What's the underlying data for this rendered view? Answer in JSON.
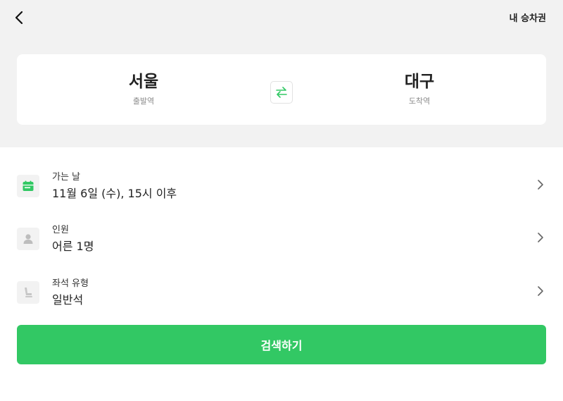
{
  "header": {
    "back_icon": "chevron-left-icon",
    "tickets_label": "내 승차권"
  },
  "route": {
    "departure": {
      "name": "서울",
      "role": "출발역"
    },
    "arrival": {
      "name": "대구",
      "role": "도착역"
    },
    "swap_icon": "swap-arrows-icon",
    "swap_color": "#32c864"
  },
  "options": [
    {
      "label": "가는 날",
      "value": "11월 6일 (수), 15시 이후",
      "icon": "calendar-icon",
      "icon_color": "#32c864"
    },
    {
      "label": "인원",
      "value": "어른 1명",
      "icon": "person-icon",
      "icon_color": "#bdbdbd"
    },
    {
      "label": "좌석 유형",
      "value": "일반석",
      "icon": "seat-icon",
      "icon_color": "#c7c7c7"
    }
  ],
  "search_button": {
    "label": "검색하기",
    "color": "#32c864"
  }
}
